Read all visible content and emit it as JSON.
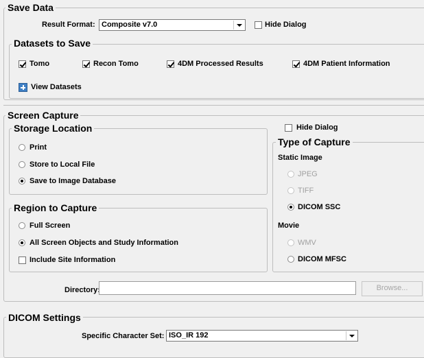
{
  "save_data": {
    "title": "Save Data",
    "result_format_label": "Result Format:",
    "result_format_value": "Composite v7.0",
    "hide_dialog_label": "Hide Dialog",
    "hide_dialog_checked": false
  },
  "datasets": {
    "title": "Datasets to Save",
    "items": [
      {
        "label": "Tomo",
        "checked": true
      },
      {
        "label": "Recon Tomo",
        "checked": true
      },
      {
        "label": "4DM Processed Results",
        "checked": true
      },
      {
        "label": "4DM Patient Information",
        "checked": true
      }
    ],
    "view_datasets_label": "View Datasets"
  },
  "screen_capture": {
    "title": "Screen Capture",
    "hide_dialog_label": "Hide Dialog",
    "hide_dialog_checked": false,
    "storage_location": {
      "title": "Storage Location",
      "options": [
        {
          "label": "Print",
          "selected": false
        },
        {
          "label": "Store to Local File",
          "selected": false
        },
        {
          "label": "Save to Image Database",
          "selected": true
        }
      ]
    },
    "region": {
      "title": "Region to Capture",
      "options": [
        {
          "label": "Full Screen",
          "selected": false
        },
        {
          "label": "All Screen Objects and Study Information",
          "selected": true
        }
      ],
      "include_site_label": "Include Site Information",
      "include_site_checked": false
    },
    "type_of_capture": {
      "title": "Type of Capture",
      "static_label": "Static Image",
      "static_options": [
        {
          "label": "JPEG",
          "enabled": false,
          "selected": false
        },
        {
          "label": "TIFF",
          "enabled": false,
          "selected": false
        },
        {
          "label": "DICOM SSC",
          "enabled": true,
          "selected": true
        }
      ],
      "movie_label": "Movie",
      "movie_options": [
        {
          "label": "WMV",
          "enabled": false,
          "selected": false
        },
        {
          "label": "DICOM MFSC",
          "enabled": true,
          "selected": false
        }
      ]
    },
    "directory_label": "Directory:",
    "directory_value": "",
    "browse_label": "Browse..."
  },
  "dicom": {
    "title": "DICOM Settings",
    "charset_label": "Specific Character Set:",
    "charset_value": "ISO_IR 192"
  }
}
